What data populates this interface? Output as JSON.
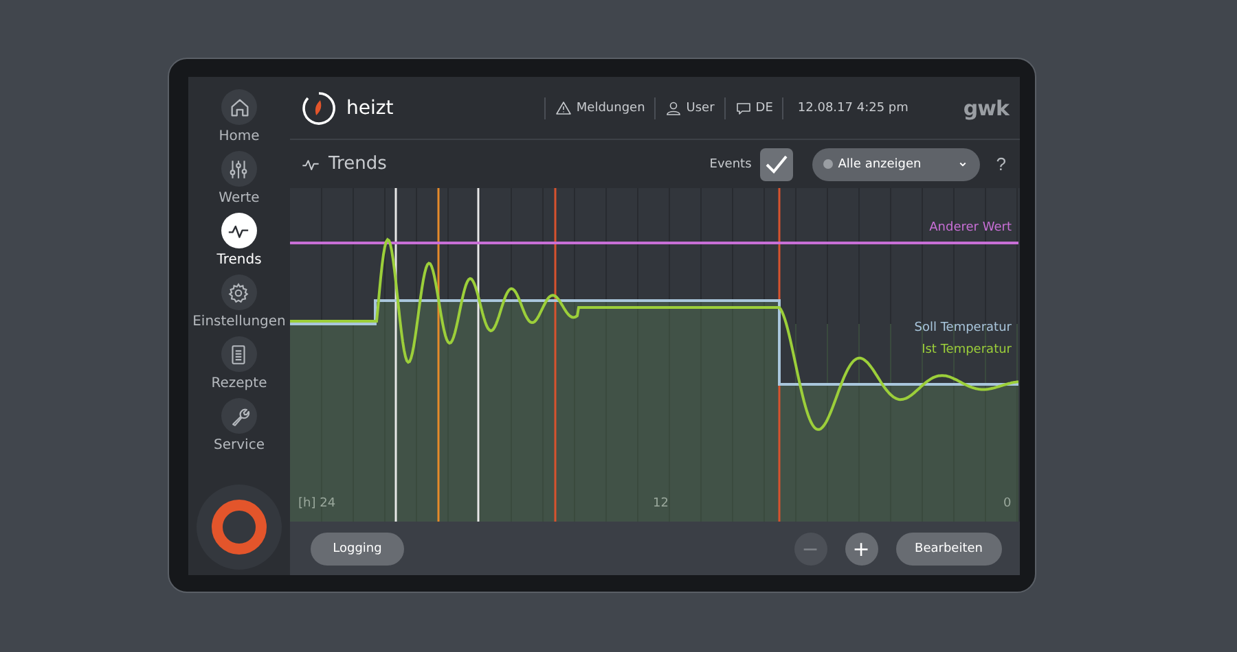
{
  "sidebar": {
    "items": [
      {
        "label": "Home",
        "selected": false
      },
      {
        "label": "Werte",
        "selected": false
      },
      {
        "label": "Trends",
        "selected": true
      },
      {
        "label": "Einstellungen",
        "selected": false
      },
      {
        "label": "Rezepte",
        "selected": false
      },
      {
        "label": "Service",
        "selected": false
      }
    ]
  },
  "header": {
    "status": "heizt",
    "items": [
      {
        "label": "Meldungen"
      },
      {
        "label": "User"
      },
      {
        "label": "DE"
      }
    ],
    "datetime": "12.08.17 4:25 pm",
    "brand": "gwk"
  },
  "toolbar": {
    "title": "Trends",
    "events_label": "Events",
    "events_checked": true,
    "filter": "Alle anzeigen",
    "help": "?"
  },
  "chart": {
    "series": [
      {
        "name": "Anderer Wert",
        "color": "#c86fd6",
        "kind": "constant"
      },
      {
        "name": "Soll Temperatur",
        "color": "#a9c6dc",
        "kind": "setpoint"
      },
      {
        "name": "Ist Temperatur",
        "color": "#9ccf3a",
        "kind": "actual"
      }
    ],
    "events": [
      {
        "color": "#e8e8e8"
      },
      {
        "color": "#e58a2a"
      },
      {
        "color": "#e8e8e8"
      },
      {
        "color": "#d8532e"
      },
      {
        "color": "#d8532e"
      }
    ],
    "x_labels": [
      "[h] 24",
      "12",
      "0"
    ]
  },
  "footer": {
    "logging": "Logging",
    "zoom_out": {
      "label": "−",
      "disabled": true
    },
    "zoom_in": {
      "label": "+",
      "disabled": false
    },
    "edit": "Bearbeiten"
  }
}
